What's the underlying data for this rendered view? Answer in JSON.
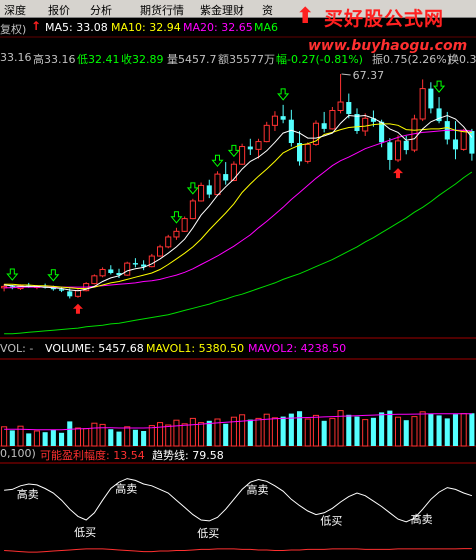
{
  "menu": [
    "深度",
    "报价",
    "分析",
    "期货行情",
    "紫金理财",
    "资"
  ],
  "ma_row": {
    "prefix": "复权)",
    "ma5": "MA5: 33.08",
    "ma10": "MA10: 32.94",
    "ma20": "MA20: 32.65",
    "ma60": "MA6"
  },
  "quote": {
    "open": "33.16",
    "high": "高33.16",
    "low": "低32.41",
    "close": "收32.89",
    "vol": "量5457.7",
    "amount": "额35577万",
    "change": "幅-0.27(-0.81%)",
    "swing": "振0.75(2.26%)",
    "turnover": "换0.3"
  },
  "peak_label": "67.37",
  "volume": {
    "title": "VOL: -",
    "volume": "VOLUME: 5457.68",
    "mavol1": "MAVOL1: 5380.50",
    "mavol2": "MAVOL2: 4238.50"
  },
  "indicator": {
    "params": "0,100)",
    "profit": "可能盈利幅度: 13.54",
    "trend": "趋势线: 79.58"
  },
  "signal_labels": [
    "高卖",
    "低买",
    "高卖",
    "低买",
    "高卖",
    "低买",
    "高卖"
  ],
  "watermark": {
    "title": "买好股公式网",
    "url": "www.buyhaogu.com"
  },
  "chart_data": {
    "type": "candlestick",
    "candles": [
      [
        37.1,
        37.6,
        36.6,
        37.3
      ],
      [
        37.3,
        37.5,
        36.9,
        37.1
      ],
      [
        37.0,
        37.6,
        36.8,
        37.4
      ],
      [
        37.4,
        37.8,
        37.1,
        37.2
      ],
      [
        37.2,
        37.5,
        36.9,
        37.3
      ],
      [
        37.3,
        37.7,
        37.0,
        37.1
      ],
      [
        37.1,
        37.4,
        36.7,
        36.9
      ],
      [
        36.9,
        37.2,
        36.5,
        36.7
      ],
      [
        36.6,
        37.0,
        35.6,
        35.9
      ],
      [
        35.9,
        36.9,
        35.7,
        36.7
      ],
      [
        36.7,
        37.9,
        36.6,
        37.7
      ],
      [
        37.7,
        39.0,
        37.6,
        38.8
      ],
      [
        38.8,
        40.0,
        38.6,
        39.7
      ],
      [
        39.7,
        40.3,
        39.0,
        39.2
      ],
      [
        39.2,
        39.8,
        38.5,
        38.9
      ],
      [
        38.9,
        40.8,
        38.8,
        40.6
      ],
      [
        40.6,
        41.3,
        40.0,
        40.4
      ],
      [
        40.4,
        41.0,
        39.6,
        40.1
      ],
      [
        40.1,
        41.9,
        40.0,
        41.6
      ],
      [
        41.6,
        43.2,
        41.5,
        42.9
      ],
      [
        42.9,
        44.6,
        42.7,
        44.3
      ],
      [
        44.3,
        45.6,
        43.9,
        45.1
      ],
      [
        45.1,
        47.2,
        45.0,
        46.9
      ],
      [
        46.9,
        49.7,
        46.8,
        49.4
      ],
      [
        49.4,
        52.0,
        49.3,
        51.6
      ],
      [
        51.6,
        52.4,
        49.8,
        50.3
      ],
      [
        50.3,
        53.6,
        50.2,
        53.2
      ],
      [
        53.2,
        54.9,
        51.7,
        52.3
      ],
      [
        52.3,
        55.0,
        52.2,
        54.6
      ],
      [
        54.6,
        57.5,
        54.5,
        57.1
      ],
      [
        57.1,
        58.2,
        55.9,
        56.7
      ],
      [
        56.7,
        58.2,
        55.4,
        57.8
      ],
      [
        57.8,
        60.6,
        57.7,
        60.1
      ],
      [
        60.1,
        62.1,
        59.3,
        61.4
      ],
      [
        61.4,
        63.0,
        60.4,
        60.9
      ],
      [
        60.9,
        62.3,
        57.1,
        57.6
      ],
      [
        57.6,
        59.3,
        54.4,
        55.0
      ],
      [
        55.0,
        57.7,
        54.7,
        57.4
      ],
      [
        57.4,
        60.8,
        57.2,
        60.4
      ],
      [
        60.4,
        62.0,
        59.1,
        59.6
      ],
      [
        59.6,
        62.7,
        59.5,
        62.2
      ],
      [
        62.2,
        67.37,
        61.8,
        63.4
      ],
      [
        63.4,
        64.6,
        61.1,
        61.7
      ],
      [
        61.7,
        62.5,
        58.9,
        59.3
      ],
      [
        59.3,
        61.8,
        58.6,
        61.1
      ],
      [
        61.1,
        62.2,
        59.9,
        60.6
      ],
      [
        60.6,
        60.9,
        57.0,
        57.7
      ],
      [
        57.7,
        58.3,
        53.8,
        55.2
      ],
      [
        55.2,
        58.7,
        54.9,
        57.9
      ],
      [
        57.9,
        58.6,
        56.0,
        56.6
      ],
      [
        56.6,
        61.6,
        56.3,
        61.0
      ],
      [
        61.0,
        66.6,
        60.7,
        65.3
      ],
      [
        65.3,
        66.2,
        61.8,
        62.5
      ],
      [
        62.5,
        64.1,
        60.4,
        60.7
      ],
      [
        60.7,
        62.0,
        57.4,
        58.1
      ],
      [
        58.1,
        60.7,
        55.3,
        56.7
      ],
      [
        56.7,
        59.6,
        56.5,
        59.3
      ],
      [
        59.3,
        59.6,
        55.1,
        56.1
      ]
    ],
    "ma5": [
      37.5,
      37.4,
      37.3,
      37.3,
      37.3,
      37.2,
      37.1,
      37.0,
      36.8,
      36.7,
      36.9,
      37.3,
      38.0,
      38.5,
      38.8,
      39.5,
      39.8,
      40.0,
      40.5,
      41.2,
      42.0,
      42.9,
      44.0,
      45.6,
      47.4,
      48.7,
      50.2,
      51.4,
      52.5,
      53.9,
      55.0,
      55.6,
      56.5,
      57.7,
      59.0,
      59.4,
      59.0,
      58.3,
      58.3,
      58.6,
      59.0,
      60.4,
      61.5,
      61.4,
      61.5,
      61.1,
      60.5,
      59.6,
      59.1,
      58.0,
      58.2,
      59.6,
      60.6,
      61.1,
      61.5,
      61.0,
      59.9,
      58.4
    ],
    "ma10": [
      37.6,
      37.6,
      37.5,
      37.5,
      37.4,
      37.4,
      37.3,
      37.2,
      37.1,
      37.0,
      37.0,
      37.2,
      37.5,
      37.8,
      38.0,
      38.3,
      38.6,
      38.9,
      39.2,
      39.7,
      40.4,
      41.2,
      42.0,
      42.9,
      44.0,
      45.3,
      46.5,
      47.7,
      49.0,
      50.6,
      51.8,
      52.9,
      53.9,
      55.0,
      56.2,
      56.8,
      57.3,
      57.5,
      57.9,
      58.8,
      59.1,
      59.5,
      59.8,
      59.9,
      60.0,
      60.2,
      60.3,
      60.3,
      60.1,
      59.5,
      59.4,
      59.5,
      59.6,
      59.6,
      59.8,
      59.4,
      59.2,
      59.1
    ],
    "ma20": [
      37.1,
      37.1,
      37.2,
      37.2,
      37.2,
      37.2,
      37.2,
      37.2,
      37.2,
      37.2,
      37.2,
      37.3,
      37.4,
      37.5,
      37.6,
      37.7,
      37.8,
      38.0,
      38.1,
      38.3,
      38.6,
      38.9,
      39.3,
      39.8,
      40.4,
      41.0,
      41.6,
      42.3,
      43.0,
      43.8,
      44.6,
      45.6,
      46.5,
      47.5,
      48.5,
      49.6,
      50.6,
      51.6,
      52.6,
      53.5,
      54.4,
      55.1,
      55.6,
      56.2,
      56.8,
      57.2,
      57.6,
      58.0,
      58.4,
      58.7,
      58.9,
      59.1,
      59.2,
      59.3,
      59.4,
      59.4,
      59.4,
      59.3
    ],
    "ma60": [
      30.6,
      30.6,
      30.7,
      30.8,
      30.9,
      31.0,
      31.1,
      31.2,
      31.3,
      31.4,
      31.6,
      31.7,
      31.8,
      32.0,
      32.1,
      32.3,
      32.5,
      32.7,
      32.9,
      33.1,
      33.3,
      33.6,
      33.9,
      34.2,
      34.5,
      34.8,
      35.2,
      35.5,
      35.9,
      36.2,
      36.6,
      37.0,
      37.4,
      37.8,
      38.3,
      38.7,
      39.1,
      39.6,
      40.1,
      40.6,
      41.1,
      41.7,
      42.3,
      42.9,
      43.6,
      44.2,
      44.9,
      45.6,
      46.3,
      47.0,
      47.8,
      48.5,
      49.3,
      50.2,
      51.0,
      51.8,
      52.7,
      53.5
    ],
    "volumes": [
      3200,
      2600,
      3300,
      2100,
      2500,
      2300,
      2700,
      2200,
      4100,
      3000,
      2900,
      3800,
      3600,
      2800,
      2400,
      3200,
      2700,
      2500,
      3400,
      3900,
      3500,
      4300,
      3700,
      4600,
      3900,
      4200,
      4500,
      3700,
      4800,
      5200,
      4400,
      4600,
      5300,
      4700,
      4900,
      5400,
      5800,
      4500,
      5100,
      4200,
      4600,
      5900,
      5200,
      4900,
      4400,
      4700,
      5600,
      5900,
      4800,
      4300,
      4900,
      5700,
      5400,
      5100,
      4600,
      5300,
      5400,
      5457.68
    ],
    "mavol": [
      2800,
      2800,
      2800,
      2750,
      2700,
      2700,
      2700,
      2700,
      2800,
      2850,
      2900,
      3000,
      3050,
      3050,
      3000,
      3000,
      3000,
      3000,
      3050,
      3150,
      3250,
      3350,
      3450,
      3550,
      3650,
      3750,
      3850,
      3950,
      4050,
      4150,
      4250,
      4350,
      4450,
      4550,
      4600,
      4650,
      4700,
      4750,
      4800,
      4850,
      4900,
      4950,
      5000,
      5050,
      5100,
      5150,
      5200,
      5250,
      5300,
      5300,
      5320,
      5340,
      5360,
      5370,
      5380,
      5380,
      5380,
      5380.5
    ],
    "signal": [
      73,
      74,
      78,
      80,
      79,
      75,
      70,
      62,
      52,
      44,
      40,
      48,
      62,
      75,
      82,
      86,
      84,
      80,
      78,
      74,
      70,
      62,
      54,
      46,
      40,
      39,
      43,
      52,
      63,
      74,
      82,
      85,
      83,
      78,
      72,
      63,
      56,
      50,
      46,
      48,
      53,
      60,
      66,
      70,
      67,
      61,
      55,
      48,
      41,
      38,
      42,
      52,
      63,
      71,
      76,
      74,
      70,
      67
    ],
    "profit": [
      10,
      9,
      8,
      7,
      7,
      8,
      9,
      10,
      11,
      12,
      13,
      13,
      13,
      12,
      11,
      10,
      9,
      8,
      8,
      9,
      9,
      10,
      10,
      11,
      12,
      12,
      13,
      13,
      13,
      12,
      12,
      11,
      11,
      10,
      10,
      11,
      11,
      12,
      12,
      12,
      13,
      13,
      13,
      13,
      12,
      12,
      12,
      12,
      13,
      13,
      13,
      13,
      13,
      13,
      13,
      13,
      13.5,
      13.54
    ]
  }
}
